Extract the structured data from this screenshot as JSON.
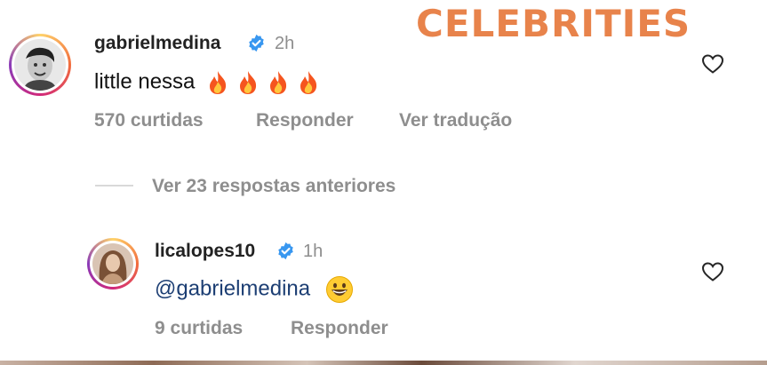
{
  "overlay": {
    "title": "CELEBRITIES",
    "color": "#e8834b"
  },
  "comments": [
    {
      "username": "gabrielmedina",
      "verified": true,
      "time": "2h",
      "text": "little nessa",
      "emojis": [
        "fire",
        "fire",
        "fire",
        "fire"
      ],
      "likes": "570 curtidas",
      "reply_label": "Responder",
      "translate_label": "Ver tradução",
      "avatar_icon": "profile-photo"
    },
    {
      "username": "licalopes10",
      "verified": true,
      "time": "1h",
      "mention": "@gabrielmedina",
      "emojis": [
        "grinning-face"
      ],
      "likes": "9 curtidas",
      "reply_label": "Responder",
      "avatar_icon": "profile-photo"
    }
  ],
  "thread": {
    "view_previous_replies": "Ver 23 respostas anteriores"
  },
  "colors": {
    "verified": "#3897f0",
    "muted": "#8e8e8e",
    "mention": "#1c3e73"
  }
}
